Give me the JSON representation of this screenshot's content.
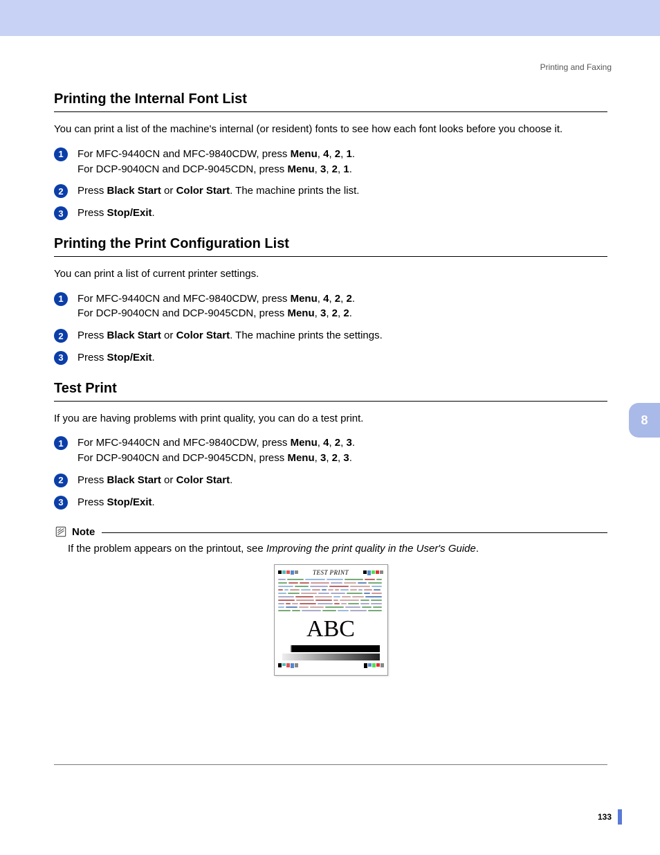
{
  "header": {
    "breadcrumb": "Printing and Faxing"
  },
  "sideTab": {
    "label": "8"
  },
  "pageNumber": "133",
  "sections": [
    {
      "heading": "Printing the Internal Font List",
      "intro": "You can print a list of the machine's internal (or resident) fonts to see how each font looks before you choose it.",
      "steps": [
        {
          "num": "1",
          "lines": [
            {
              "segments": [
                {
                  "t": "For MFC-9440CN and MFC-9840CDW, press "
                },
                {
                  "t": "Menu",
                  "b": true
                },
                {
                  "t": ", "
                },
                {
                  "t": "4",
                  "b": true
                },
                {
                  "t": ", "
                },
                {
                  "t": "2",
                  "b": true
                },
                {
                  "t": ", "
                },
                {
                  "t": "1",
                  "b": true
                },
                {
                  "t": "."
                }
              ]
            },
            {
              "segments": [
                {
                  "t": "For DCP-9040CN and DCP-9045CDN, press "
                },
                {
                  "t": "Menu",
                  "b": true
                },
                {
                  "t": ", "
                },
                {
                  "t": "3",
                  "b": true
                },
                {
                  "t": ", "
                },
                {
                  "t": "2",
                  "b": true
                },
                {
                  "t": ", "
                },
                {
                  "t": "1",
                  "b": true
                },
                {
                  "t": "."
                }
              ]
            }
          ]
        },
        {
          "num": "2",
          "lines": [
            {
              "segments": [
                {
                  "t": "Press "
                },
                {
                  "t": "Black Start",
                  "b": true
                },
                {
                  "t": " or "
                },
                {
                  "t": "Color Start",
                  "b": true
                },
                {
                  "t": ". The machine prints the list."
                }
              ]
            }
          ]
        },
        {
          "num": "3",
          "lines": [
            {
              "segments": [
                {
                  "t": "Press "
                },
                {
                  "t": "Stop/Exit",
                  "b": true
                },
                {
                  "t": "."
                }
              ]
            }
          ]
        }
      ]
    },
    {
      "heading": "Printing the Print Configuration List",
      "intro": "You can print a list of current printer settings.",
      "steps": [
        {
          "num": "1",
          "lines": [
            {
              "segments": [
                {
                  "t": "For MFC-9440CN and MFC-9840CDW, press "
                },
                {
                  "t": "Menu",
                  "b": true
                },
                {
                  "t": ", "
                },
                {
                  "t": "4",
                  "b": true
                },
                {
                  "t": ", "
                },
                {
                  "t": "2",
                  "b": true
                },
                {
                  "t": ", "
                },
                {
                  "t": "2",
                  "b": true
                },
                {
                  "t": "."
                }
              ]
            },
            {
              "segments": [
                {
                  "t": "For DCP-9040CN and DCP-9045CDN, press "
                },
                {
                  "t": "Menu",
                  "b": true
                },
                {
                  "t": ", "
                },
                {
                  "t": "3",
                  "b": true
                },
                {
                  "t": ", "
                },
                {
                  "t": "2",
                  "b": true
                },
                {
                  "t": ", "
                },
                {
                  "t": "2",
                  "b": true
                },
                {
                  "t": "."
                }
              ]
            }
          ]
        },
        {
          "num": "2",
          "lines": [
            {
              "segments": [
                {
                  "t": "Press "
                },
                {
                  "t": "Black Start",
                  "b": true
                },
                {
                  "t": " or "
                },
                {
                  "t": "Color Start",
                  "b": true
                },
                {
                  "t": ". The machine prints the settings."
                }
              ]
            }
          ]
        },
        {
          "num": "3",
          "lines": [
            {
              "segments": [
                {
                  "t": "Press "
                },
                {
                  "t": "Stop/Exit",
                  "b": true
                },
                {
                  "t": "."
                }
              ]
            }
          ]
        }
      ]
    },
    {
      "heading": "Test Print",
      "intro": "If you are having problems with print quality, you can do a test print.",
      "steps": [
        {
          "num": "1",
          "lines": [
            {
              "segments": [
                {
                  "t": "For MFC-9440CN and MFC-9840CDW, press "
                },
                {
                  "t": "Menu",
                  "b": true
                },
                {
                  "t": ", "
                },
                {
                  "t": "4",
                  "b": true
                },
                {
                  "t": ", "
                },
                {
                  "t": "2",
                  "b": true
                },
                {
                  "t": ", "
                },
                {
                  "t": "3",
                  "b": true
                },
                {
                  "t": "."
                }
              ]
            },
            {
              "segments": [
                {
                  "t": "For DCP-9040CN and DCP-9045CDN, press "
                },
                {
                  "t": "Menu",
                  "b": true
                },
                {
                  "t": ", "
                },
                {
                  "t": "3",
                  "b": true
                },
                {
                  "t": ", "
                },
                {
                  "t": "2",
                  "b": true
                },
                {
                  "t": ", "
                },
                {
                  "t": "3",
                  "b": true
                },
                {
                  "t": "."
                }
              ]
            }
          ]
        },
        {
          "num": "2",
          "lines": [
            {
              "segments": [
                {
                  "t": "Press "
                },
                {
                  "t": "Black Start",
                  "b": true
                },
                {
                  "t": " or "
                },
                {
                  "t": "Color Start",
                  "b": true
                },
                {
                  "t": "."
                }
              ]
            }
          ]
        },
        {
          "num": "3",
          "lines": [
            {
              "segments": [
                {
                  "t": "Press "
                },
                {
                  "t": "Stop/Exit",
                  "b": true
                },
                {
                  "t": "."
                }
              ]
            }
          ]
        }
      ],
      "note": {
        "label": "Note",
        "text_segments": [
          {
            "t": "If the problem appears on the printout, see "
          },
          {
            "t": "Improving the print quality in the User's Guide",
            "i": true
          },
          {
            "t": "."
          }
        ]
      },
      "figure": {
        "title": "TEST PRINT",
        "sample": "ABC"
      }
    }
  ]
}
